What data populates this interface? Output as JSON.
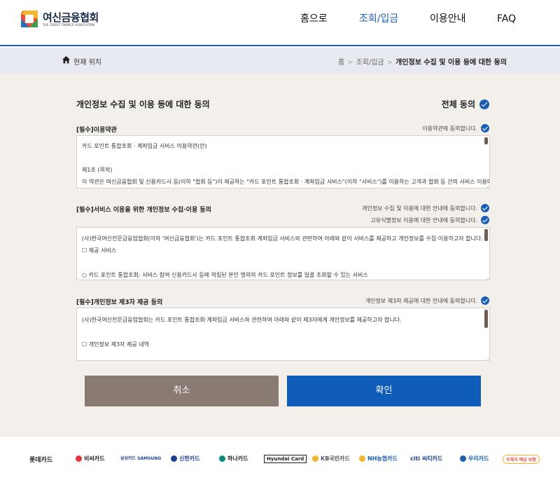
{
  "header": {
    "logo_name": "여신금융협회",
    "logo_sub": "THE CREDIT FINANCE ASSOCIATION",
    "nav": [
      "홈으로",
      "조회/입금",
      "이용안내",
      "FAQ"
    ],
    "active_nav": "조회/입금"
  },
  "breadcrumb": {
    "label": "현재 위치",
    "items": [
      "홈",
      "조회/입금",
      "개인정보 수집 및 이용 등에 대한 동의"
    ]
  },
  "main": {
    "title": "개인정보 수집 및 이용 등에 대한 동의",
    "agree_all": "전체 동의",
    "sections": [
      {
        "title": "[필수]이용약관",
        "agrees": [
          "이용약관에 동의합니다."
        ],
        "lines": [
          "카드 포인트 통합조회 · 계좌입금 서비스 이용약관(안)",
          "",
          "제1조 (목적)",
          "이 약관은 여신금융협회 및 신용카드사 등(이하 \"협회 등\")이 제공하는 \"카드 포인트 통합조회 · 계좌입금 서비스\"(이하 \"서비스\")를 이용하는 고객과 협회 등 간의 서비스 이용에"
        ]
      },
      {
        "title": "[필수]서비스 이용을 위한 개인정보 수집·이용 동의",
        "agrees": [
          "개인정보 수집 및 이용에 대한 안내에 동의합니다.",
          "고유식별정보 이용에 대한 안내에 동의합니다."
        ],
        "lines": [
          "(사)한국여신전문금융업협회(이하 '여신금융협회')는 카드 포인트 통합조회·계좌입금 서비스와 관련하여 아래와 같이 서비스를 제공하고 개인정보를 수집·이용하고자 합니다.",
          "☐ 제공 서비스",
          "",
          "  ○ 카드 포인트 통합조회: 서비스 참여 신용카드사 등에 적립된 본인 명의의 카드 포인트 정보를 일괄 조회할 수 있는 서비스"
        ]
      },
      {
        "title": "[필수]개인정보 제3자 제공 동의",
        "agrees": [
          "개인정보 제3자 제공에 대한 안내에 동의합니다."
        ],
        "lines": [
          "(사)한국여신전문금융업협회는 카드 포인트 통합조회·계좌입금 서비스와 관련하여 아래와 같이 제3자에게 개인정보를 제공하고자 합니다.",
          "",
          "☐ 개인정보 제3자 제공 내역"
        ]
      }
    ],
    "buttons": {
      "cancel": "취소",
      "confirm": "확인"
    }
  },
  "partners": [
    "롯데카드",
    "비씨카드",
    "삼성카드 SAMSUNG",
    "신한카드",
    "하나카드",
    "Hyundai Card",
    "KB국민카드",
    "NH농협카드",
    "citi 씨티카드",
    "우리카드",
    "우체국 예금 보험"
  ],
  "colors": {
    "accent": "#1a5fb4",
    "cancel": "#8a7b72",
    "confirm": "#0f5db8",
    "bg": "#f3f0ec"
  }
}
